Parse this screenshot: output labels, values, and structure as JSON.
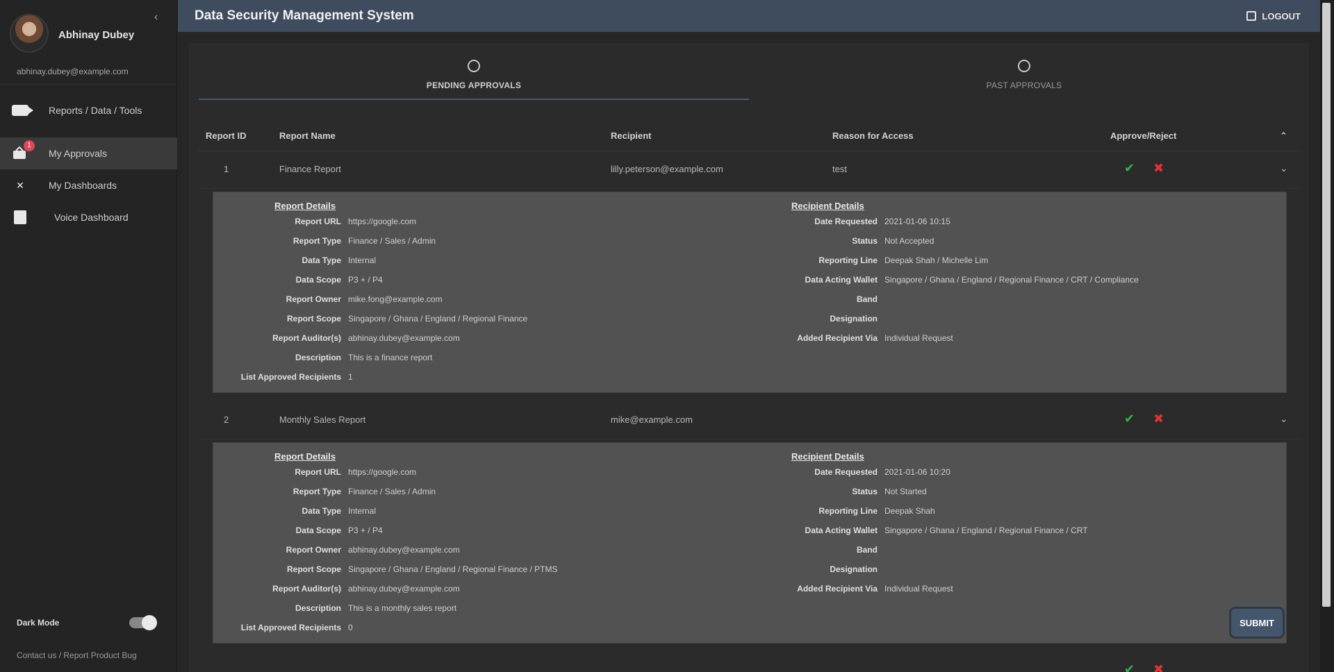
{
  "app": {
    "title": "Data Security Management System",
    "logout_label": "LOGOUT"
  },
  "user": {
    "name": "Abhinay Dubey",
    "email": "abhinay.dubey@example.com"
  },
  "sidebar": {
    "items": [
      {
        "label": "Reports / Data / Tools",
        "icon": "video-icon"
      },
      {
        "label": "My Approvals",
        "icon": "approvals-icon",
        "badge": "1"
      },
      {
        "label": "My Dashboards",
        "icon": "x-icon"
      },
      {
        "label": "Voice Dashboard",
        "icon": "document-icon"
      }
    ],
    "dark_mode_label": "Dark Mode",
    "footer": "Contact us / Report Product Bug"
  },
  "tabs": [
    {
      "label": "PENDING APPROVALS"
    },
    {
      "label": "PAST APPROVALS"
    }
  ],
  "table": {
    "columns": [
      "Report ID",
      "Report Name",
      "Recipient",
      "Reason for Access",
      "Approve/Reject"
    ],
    "rows": [
      {
        "id": "1",
        "name": "Finance Report",
        "recipient": "lilly.peterson@example.com",
        "reason": "test"
      },
      {
        "id": "2",
        "name": "Monthly Sales Report",
        "recipient": "mike@example.com",
        "reason": ""
      }
    ]
  },
  "details": {
    "report_title": "Report Details",
    "recipient_title": "Recipient Details",
    "report_labels": [
      "Report URL",
      "Report Type",
      "Data Type",
      "Data Scope",
      "Report Owner",
      "Report Scope",
      "Report Auditor(s)",
      "Description",
      "List Approved Recipients"
    ],
    "recipient_labels": [
      "Date Requested",
      "Status",
      "Reporting Line",
      "Data Acting Wallet",
      "Band",
      "Designation",
      "Added Recipient Via"
    ],
    "items": [
      {
        "report_values": [
          "https://google.com",
          "Finance / Sales / Admin",
          "Internal",
          "P3 + / P4",
          "mike.fong@example.com",
          "Singapore / Ghana / England / Regional Finance",
          "abhinay.dubey@example.com",
          "This is a finance report",
          "1"
        ],
        "recipient_values": [
          "2021-01-06 10:15",
          "Not Accepted",
          "Deepak Shah / Michelle Lim",
          "Singapore / Ghana / England / Regional Finance / CRT / Compliance",
          "",
          "",
          "Individual Request"
        ]
      },
      {
        "report_values": [
          "https://google.com",
          "Finance / Sales / Admin",
          "Internal",
          "P3 + / P4",
          "abhinay.dubey@example.com",
          "Singapore / Ghana / England / Regional Finance / PTMS",
          "abhinay.dubey@example.com",
          "This is a monthly sales report",
          "0"
        ],
        "recipient_values": [
          "2021-01-06 10:20",
          "Not Started",
          "Deepak Shah",
          "Singapore / Ghana / England / Regional Finance / CRT",
          "",
          "",
          "Individual Request"
        ]
      }
    ]
  },
  "submit_label": "SUBMIT",
  "colors": {
    "header": "#3e4c5e",
    "approve": "#34b34a",
    "reject": "#e03333",
    "badge": "#e0455b"
  }
}
